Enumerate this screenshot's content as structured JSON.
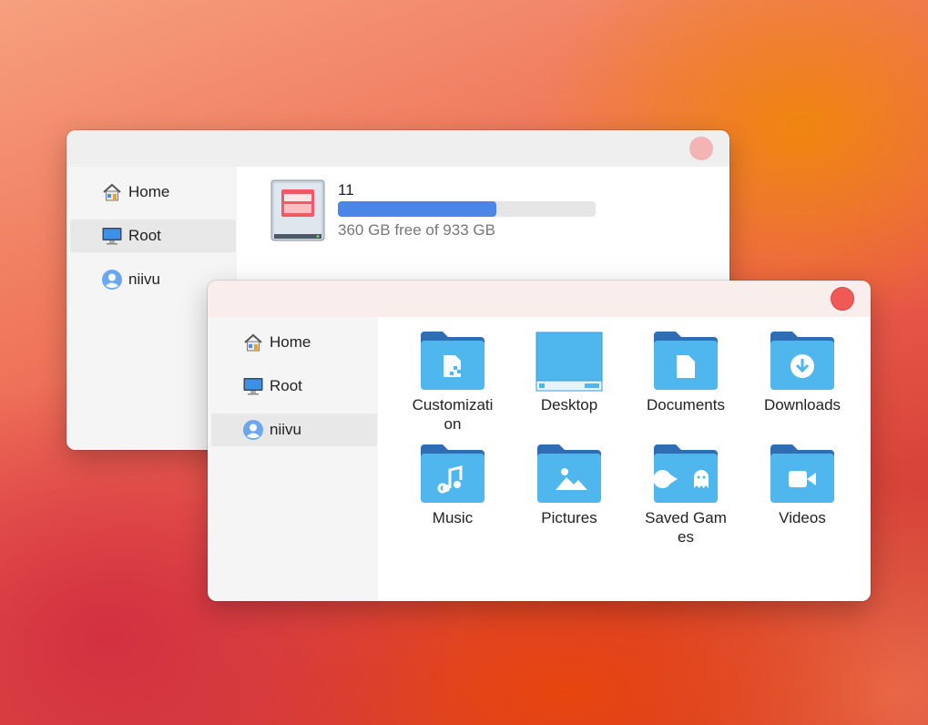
{
  "back_window": {
    "sidebar": {
      "items": [
        {
          "label": "Home",
          "icon": "home-icon"
        },
        {
          "label": "Root",
          "icon": "computer-icon",
          "active": true
        },
        {
          "label": "niivu",
          "icon": "user-icon"
        }
      ]
    },
    "drive": {
      "name": "11",
      "free_text": "360 GB free of 933 GB",
      "used_fraction": 0.614,
      "icon": "hard-drive-icon"
    },
    "close_color": "#f2b5b4"
  },
  "front_window": {
    "sidebar": {
      "items": [
        {
          "label": "Home",
          "icon": "home-icon"
        },
        {
          "label": "Root",
          "icon": "computer-icon"
        },
        {
          "label": "niivu",
          "icon": "user-icon",
          "active": true
        }
      ]
    },
    "folders": [
      {
        "label": "Customization",
        "icon": "customization-folder-icon"
      },
      {
        "label": "Desktop",
        "icon": "desktop-folder-icon"
      },
      {
        "label": "Documents",
        "icon": "documents-folder-icon"
      },
      {
        "label": "Downloads",
        "icon": "downloads-folder-icon"
      },
      {
        "label": "Music",
        "icon": "music-folder-icon"
      },
      {
        "label": "Pictures",
        "icon": "pictures-folder-icon"
      },
      {
        "label": "Saved Games",
        "icon": "saved-games-folder-icon"
      },
      {
        "label": "Videos",
        "icon": "videos-folder-icon"
      }
    ],
    "close_color": "#f05a56"
  },
  "colors": {
    "folder_back": "#2f6db5",
    "folder_front": "#4fb6ee",
    "drive_bar": "#4a86e8"
  }
}
